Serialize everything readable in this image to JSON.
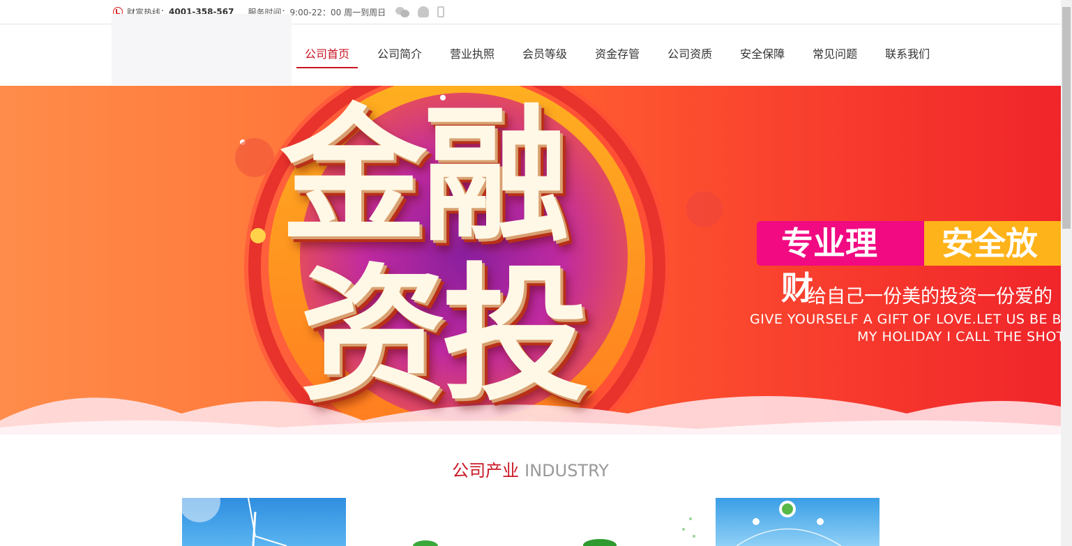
{
  "topbar": {
    "hotline_label": "财富热线：",
    "hotline_number": "4001-358-567",
    "service_hours": "服务时间：9:00-22：00 周一到周日"
  },
  "nav": {
    "items": [
      {
        "label": "公司首页",
        "active": true
      },
      {
        "label": "公司简介"
      },
      {
        "label": "营业执照"
      },
      {
        "label": "会员等级"
      },
      {
        "label": "资金存管"
      },
      {
        "label": "公司资质"
      },
      {
        "label": "安全保障"
      },
      {
        "label": "常见问题"
      },
      {
        "label": "联系我们"
      }
    ]
  },
  "banner": {
    "headline_line1": "金融",
    "headline_line2": "资投",
    "tag_left": "专业理财",
    "tag_right": "安全放",
    "slogan_cn": "给自己一份美的投资一份爱的",
    "slogan_en1": "GIVE YOURSELF A GIFT OF LOVE.LET US BE BEAUTI",
    "slogan_en2": "MY HOLIDAY I CALL THE SHOTS"
  },
  "section": {
    "title_cn": "公司产业",
    "title_en": "INDUSTRY"
  },
  "colors": {
    "accent": "#c81623",
    "pink_tag": "#f10a82",
    "orange_tag": "#ffb31a"
  }
}
